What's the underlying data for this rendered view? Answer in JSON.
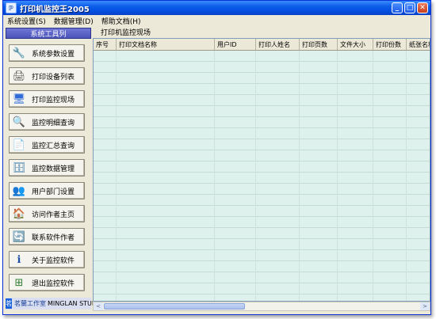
{
  "window": {
    "title": "打印机监控王2005"
  },
  "titlebar": {
    "app_icon": "printer-app-icon",
    "min": "_",
    "max": "□",
    "close": "✕"
  },
  "menubar": [
    {
      "label": "系统设置(S)"
    },
    {
      "label": "数据管理(D)"
    },
    {
      "label": "帮助文档(H)"
    }
  ],
  "sidebar": {
    "header": "系统工具列",
    "buttons": [
      {
        "label": "系统参数设置",
        "icon": "tools-icon",
        "glyph": "🔧"
      },
      {
        "label": "打印设备列表",
        "icon": "printer-icon",
        "glyph": "🖨"
      },
      {
        "label": "打印监控现场",
        "icon": "monitor-icon",
        "glyph": "🖥"
      },
      {
        "label": "监控明细查询",
        "icon": "magnifier-icon",
        "glyph": "🔍"
      },
      {
        "label": "监控汇总查询",
        "icon": "document-icon",
        "glyph": "📄"
      },
      {
        "label": "监控数据管理",
        "icon": "database-icon",
        "glyph": "🗄"
      },
      {
        "label": "用户部门设置",
        "icon": "users-icon",
        "glyph": "👥"
      },
      {
        "label": "访问作者主页",
        "icon": "home-icon",
        "glyph": "🏠"
      },
      {
        "label": "联系软件作者",
        "icon": "contact-icon",
        "glyph": "🔄"
      },
      {
        "label": "关于监控软件",
        "icon": "info-icon",
        "glyph": "ℹ"
      },
      {
        "label": "退出监控软件",
        "icon": "exit-icon",
        "glyph": "⊞"
      }
    ],
    "footer": {
      "logo_cn": "茗蘭工作室",
      "logo_en": "MINGLAN STUDIO"
    }
  },
  "main": {
    "tab": "打印机监控现场",
    "columns": [
      "序号",
      "打印文档名称",
      "用户ID",
      "打印人姓名",
      "打印页数",
      "文件大小",
      "打印份数",
      "纸张名称"
    ],
    "rows": []
  },
  "scrollbar": {
    "left": "<",
    "right": ">"
  }
}
